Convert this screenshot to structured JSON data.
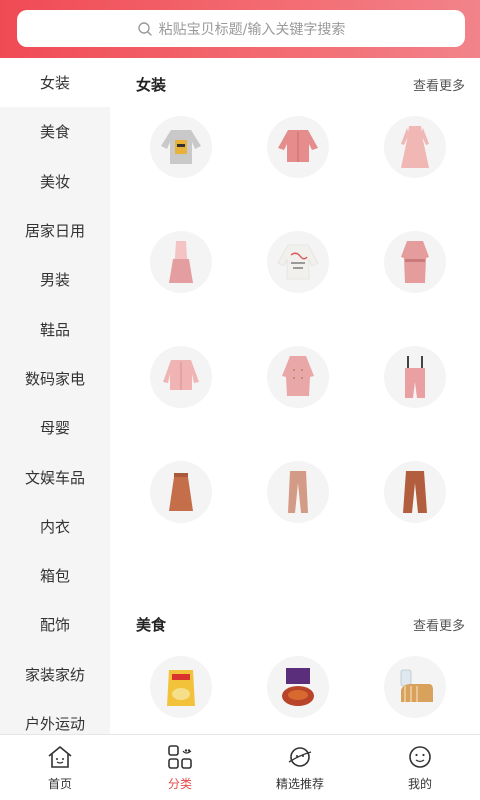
{
  "search": {
    "placeholder": "粘贴宝贝标题/输入关键字搜索"
  },
  "sidebar": {
    "items": [
      {
        "label": "女装",
        "active": true
      },
      {
        "label": "美食"
      },
      {
        "label": "美妆"
      },
      {
        "label": "居家日用"
      },
      {
        "label": "男装"
      },
      {
        "label": "鞋品"
      },
      {
        "label": "数码家电"
      },
      {
        "label": "母婴"
      },
      {
        "label": "文娱车品"
      },
      {
        "label": "内衣"
      },
      {
        "label": "箱包"
      },
      {
        "label": "配饰"
      },
      {
        "label": "家装家纺"
      },
      {
        "label": "户外运动"
      }
    ]
  },
  "sections": [
    {
      "title": "女装",
      "more": "查看更多",
      "items": [
        {
          "icon": "grey-sweatshirt-icon"
        },
        {
          "icon": "pink-jacket-icon"
        },
        {
          "icon": "pink-dress-icon"
        },
        {
          "icon": "pink-pleated-dress-icon"
        },
        {
          "icon": "white-graphic-sweatshirt-icon"
        },
        {
          "icon": "pink-belted-coat-icon"
        },
        {
          "icon": "pink-blouse-icon"
        },
        {
          "icon": "pink-trench-coat-icon"
        },
        {
          "icon": "pink-overalls-icon"
        },
        {
          "icon": "rust-skirt-icon"
        },
        {
          "icon": "tan-trousers-icon"
        },
        {
          "icon": "brown-trousers-icon"
        }
      ]
    },
    {
      "title": "美食",
      "more": "查看更多",
      "items": [
        {
          "icon": "snack-bag-icon"
        },
        {
          "icon": "crayfish-box-icon"
        },
        {
          "icon": "bread-loaf-icon"
        }
      ]
    }
  ],
  "tabbar": {
    "items": [
      {
        "label": "首页",
        "icon": "home-icon"
      },
      {
        "label": "分类",
        "icon": "category-icon",
        "active": true
      },
      {
        "label": "精选推荐",
        "icon": "planet-icon"
      },
      {
        "label": "我的",
        "icon": "smiley-icon"
      }
    ]
  },
  "colors": {
    "accent": "#e84a4f",
    "header_start": "#f04a55",
    "header_end": "#f2838a"
  }
}
